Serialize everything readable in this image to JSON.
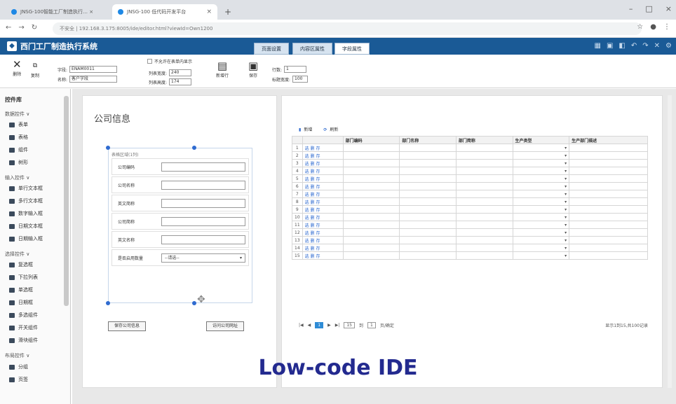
{
  "browser": {
    "tabs": [
      {
        "title": "JNSG-100智能工厂制造执行… ×"
      },
      {
        "title": "JNSG-100 低代码开发平台"
      }
    ],
    "url": "不安全 | 192.168.3.175:8005/ide/editor.html?viewId=Own1200"
  },
  "app": {
    "brand": "西门工厂制造执行系统",
    "tabs": [
      "页面设置",
      "内容区属性",
      "字段属性"
    ]
  },
  "toolbar": {
    "delete_label": "删除",
    "copy_label": "复制",
    "field_label": "字段:",
    "field_value": "ENAM0011",
    "name_label": "名称:",
    "name_value": "客户字段",
    "hidden_label": "不允许在表单内显示",
    "width_label": "列表宽度:",
    "width_value": "240",
    "height_label": "列表高度:",
    "height_value": "174",
    "new_label": "新增行",
    "save_label": "保存",
    "rows_label": "行数:",
    "rows_value": "1",
    "colwidth_label": "标题宽度:",
    "colwidth_value": "100"
  },
  "sidebar": {
    "title": "控件库",
    "groups": [
      {
        "label": "数据控件 ∨",
        "items": [
          "表单",
          "表格",
          "组件",
          "树形"
        ]
      },
      {
        "label": "输入控件 ∨",
        "items": [
          "单行文本框",
          "多行文本框",
          "数字输入框",
          "日期文本框",
          "日期输入框"
        ]
      },
      {
        "label": "选择控件 ∨",
        "items": [
          "复选框",
          "下拉列表",
          "单选框",
          "日期框",
          "多选组件",
          "开关组件",
          "滑块组件"
        ]
      },
      {
        "label": "布局控件 ∨",
        "items": [
          "分组",
          "页签"
        ]
      }
    ]
  },
  "form": {
    "title": "公司信息",
    "box_header": "表格区域(1列)",
    "fields": [
      {
        "label": "公司编码",
        "value": ""
      },
      {
        "label": "公司名称",
        "value": ""
      },
      {
        "label": "英文简称",
        "value": ""
      },
      {
        "label": "公司简称",
        "value": ""
      },
      {
        "label": "英文名称",
        "value": ""
      },
      {
        "label": "是否启用数量",
        "value": "--请选--"
      }
    ],
    "save_button": "保存公司信息",
    "visit_button": "访问公司网址"
  },
  "table": {
    "add_label": "新增",
    "refresh_label": "刷新",
    "headers": [
      "",
      "",
      "部门编码",
      "部门名称",
      "部门简称",
      "生产类型",
      "生产部门描述"
    ],
    "rows": [
      "1",
      "2",
      "3",
      "4",
      "5",
      "6",
      "7",
      "8",
      "9",
      "10",
      "11",
      "12",
      "13",
      "14",
      "15"
    ],
    "ops": "选 删 存",
    "pager": {
      "page": "1",
      "per_page": "15",
      "goto_label": "到",
      "goto_value": "1",
      "goto_suffix": "页/确定",
      "info": "显示1到15,共100记录"
    }
  },
  "caption": "Low-code IDE"
}
